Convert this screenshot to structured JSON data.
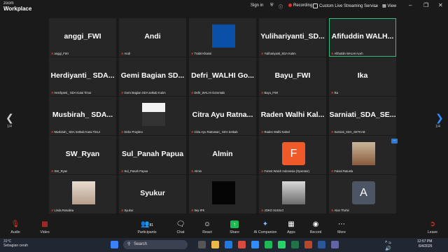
{
  "app": {
    "logo_line1": "zoom",
    "logo_line2": "Workplace"
  },
  "topbar": {
    "sign_in": "Sign in",
    "recording": "Recording",
    "live_stream": "Custom Live Streaming Service",
    "view": "View"
  },
  "tiles": [
    {
      "name": "anggi_FWI",
      "label": "anggi_FWI"
    },
    {
      "name": "Andi",
      "label": "Andi"
    },
    {
      "name": "",
      "label": "Trabit Khairul",
      "avatar": "#0a4fa8"
    },
    {
      "name": "Yulihariyanti_SD...",
      "label": "Yulihariyanti_SDA Kutim"
    },
    {
      "name": "Afifuddin WALH...",
      "label": "Afifuddin WALHI Aceh",
      "active": true
    },
    {
      "name": "Herdiyanti_ SDA...",
      "label": "Herdiyanti_ SDA Kutai Timur"
    },
    {
      "name": "Gemi Bagian SD...",
      "label": "Gemi Bagian SDA setkab Kutim"
    },
    {
      "name": "Defri_WALHI Go...",
      "label": "Defri_WALHI Gorontalo"
    },
    {
      "name": "Bayu_FWI",
      "label": "Bayu_FWI"
    },
    {
      "name": "Ika",
      "label": "Ika"
    },
    {
      "name": "Musbirah_ SDA...",
      "label": "Musbirah_ SDA Setkab Kutai Timur"
    },
    {
      "name": "",
      "label": "Deko Prayitno",
      "avatar": "photo-person"
    },
    {
      "name": "Citra Ayu Ratna...",
      "label": "Citra Ayu Ratnasari_ SDA Setkab"
    },
    {
      "name": "Raden Walhi Kal...",
      "label": "Raden Walhi Kalsel"
    },
    {
      "name": "Sarniati_SDA_SE...",
      "label": "Sarniati_SDA_SETKAB"
    },
    {
      "name": "SW_Ryan",
      "label": "SW_Ryan"
    },
    {
      "name": "Sul_Panah Papua",
      "label": "Sul_Panah Papua"
    },
    {
      "name": "Almin",
      "label": "Almin"
    },
    {
      "name": "",
      "label": "Forest Watch Indonesia (Operator)",
      "avatar": "#f05a28",
      "letter": "F"
    },
    {
      "name": "",
      "label": "Faisal Ratuela",
      "avatar": "photo-building"
    },
    {
      "name": "",
      "label": "Linda Rosalina",
      "avatar": "photo-woman"
    },
    {
      "name": "Syukur",
      "label": "Syukur"
    },
    {
      "name": "",
      "label": "Itey-IPK",
      "avatar": "#050505"
    },
    {
      "name": "",
      "label": "JOKO SUSILO",
      "avatar": "photo-man"
    },
    {
      "name": "",
      "label": "Alan Thohir",
      "avatar": "#4b5563",
      "letter": "A"
    }
  ],
  "pager": {
    "left": "1/4",
    "right": "1/4",
    "more": "..."
  },
  "bottombar": {
    "audio": "Audio",
    "video": "Video",
    "participants": "Participants",
    "participants_count": "81",
    "chat": "Chat",
    "react": "React",
    "share": "Share",
    "ai": "AI Companion",
    "apps": "Apps",
    "record": "Record",
    "more": "More",
    "leave": "Leave"
  },
  "taskbar": {
    "temp": "31°C",
    "weather": "Sebagian cerah",
    "search": "Search",
    "time": "12:57 PM",
    "date": "6/4/2025"
  }
}
